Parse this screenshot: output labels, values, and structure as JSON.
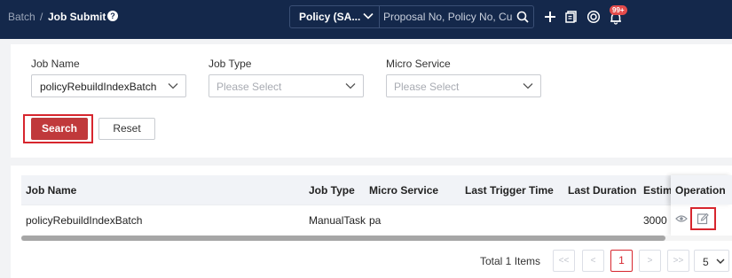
{
  "header": {
    "breadcrumb_root": "Batch",
    "breadcrumb_sep": "/",
    "breadcrumb_current": "Job Submit",
    "help_icon": "help-circle-icon",
    "search_scope": "Policy (SA...",
    "search_placeholder": "Proposal No, Policy No, Cust",
    "notification_badge": "99+",
    "icons": [
      "add-icon",
      "documents-icon",
      "target-icon",
      "bell-icon"
    ]
  },
  "filters": {
    "job_name": {
      "label": "Job Name",
      "value": "policyRebuildIndexBatch"
    },
    "job_type": {
      "label": "Job Type",
      "placeholder": "Please Select"
    },
    "micro_service": {
      "label": "Micro Service",
      "placeholder": "Please Select"
    },
    "search_button": "Search",
    "reset_button": "Reset"
  },
  "table": {
    "columns": [
      "Job Name",
      "Job Type",
      "Micro Service",
      "Last Trigger Time",
      "Last Duration",
      "Estima",
      "Operation"
    ],
    "rows": [
      {
        "job_name": "policyRebuildIndexBatch",
        "job_type": "ManualTask",
        "micro_service": "pa",
        "last_trigger_time": "",
        "last_duration": "",
        "estimated": "3000"
      }
    ]
  },
  "pagination": {
    "total": "Total 1 Items",
    "first": "<<",
    "prev": "<",
    "current": "1",
    "next": ">",
    "last": ">>",
    "page_size": "5"
  },
  "colors": {
    "header_bg": "#14284b",
    "accent": "#c0393b",
    "highlight": "#d7262e"
  }
}
